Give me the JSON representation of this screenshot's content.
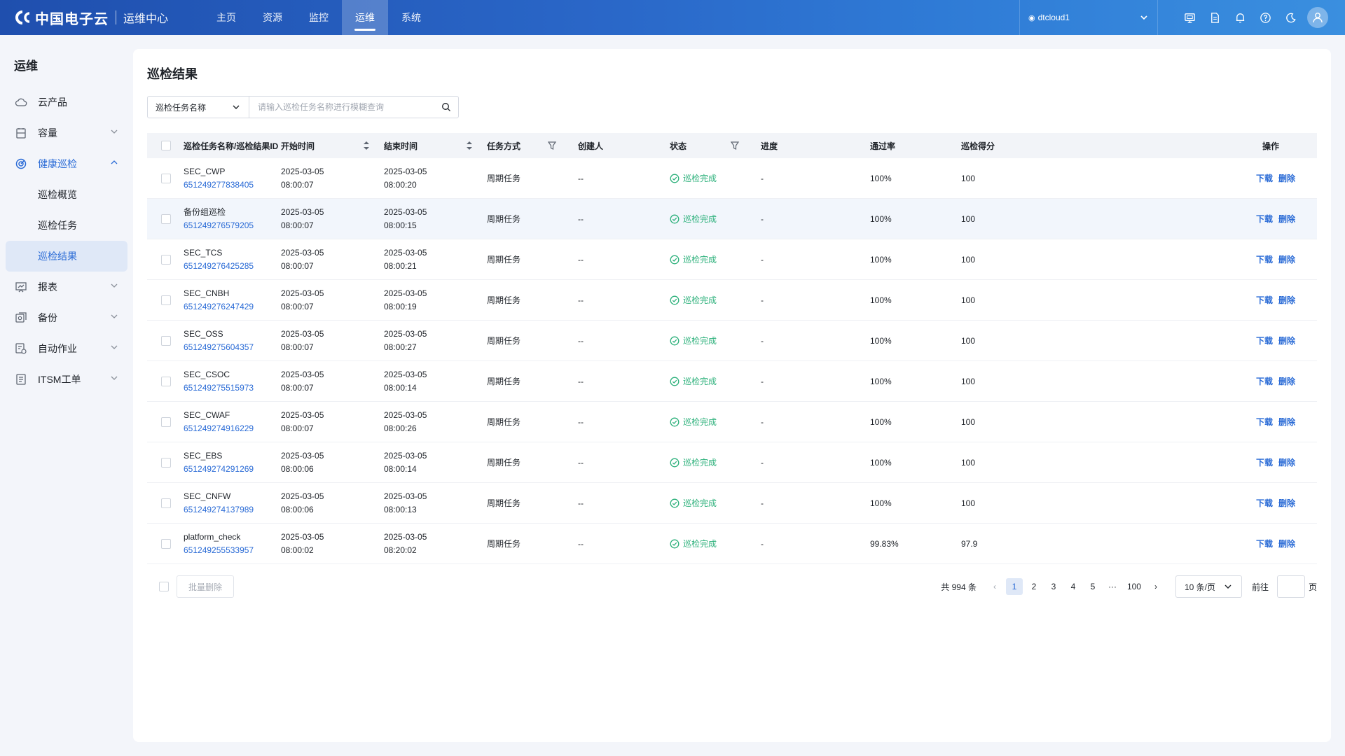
{
  "topbar": {
    "brand": "中国电子云",
    "subtitle": "运维中心",
    "nav": [
      {
        "label": "主页",
        "active": false
      },
      {
        "label": "资源",
        "active": false
      },
      {
        "label": "监控",
        "active": false
      },
      {
        "label": "运维",
        "active": true
      },
      {
        "label": "系统",
        "active": false
      }
    ],
    "tenant": "dtcloud1",
    "icons": [
      "monitor-icon",
      "document-icon",
      "bell-icon",
      "help-icon",
      "moon-icon"
    ],
    "avatar_icon": "user-icon"
  },
  "sidebar": {
    "title": "运维",
    "items": [
      {
        "label": "云产品",
        "icon": "cloud-icon",
        "has_chevron": false
      },
      {
        "label": "容量",
        "icon": "capacity-icon",
        "has_chevron": true
      },
      {
        "label": "健康巡检",
        "icon": "health-check-icon",
        "has_chevron": true,
        "open": true
      },
      {
        "label": "报表",
        "icon": "report-icon",
        "has_chevron": true
      },
      {
        "label": "备份",
        "icon": "backup-icon",
        "has_chevron": true
      },
      {
        "label": "自动作业",
        "icon": "automation-icon",
        "has_chevron": true
      },
      {
        "label": "ITSM工单",
        "icon": "ticket-icon",
        "has_chevron": true
      }
    ],
    "sub_items": [
      {
        "label": "巡检概览",
        "active": false
      },
      {
        "label": "巡检任务",
        "active": false
      },
      {
        "label": "巡检结果",
        "active": true
      }
    ]
  },
  "main": {
    "title": "巡检结果",
    "search": {
      "field": "巡检任务名称",
      "placeholder": "请输入巡检任务名称进行模糊查询"
    }
  },
  "table": {
    "columns": [
      "巡检任务名称/巡检结果ID",
      "开始时间",
      "结束时间",
      "任务方式",
      "创建人",
      "状态",
      "进度",
      "通过率",
      "巡检得分",
      "操作"
    ],
    "rows": [
      {
        "name": "SEC_CWP",
        "id": "651249277838405",
        "start_date": "2025-03-05",
        "start_time": "08:00:07",
        "end_date": "2025-03-05",
        "end_time": "08:00:20",
        "mode": "周期任务",
        "creator": "--",
        "status": "巡检完成",
        "progress": "-",
        "pass_rate": "100%",
        "score": "100"
      },
      {
        "name": "备份组巡检",
        "id": "651249276579205",
        "start_date": "2025-03-05",
        "start_time": "08:00:07",
        "end_date": "2025-03-05",
        "end_time": "08:00:15",
        "mode": "周期任务",
        "creator": "--",
        "status": "巡检完成",
        "progress": "-",
        "pass_rate": "100%",
        "score": "100"
      },
      {
        "name": "SEC_TCS",
        "id": "651249276425285",
        "start_date": "2025-03-05",
        "start_time": "08:00:07",
        "end_date": "2025-03-05",
        "end_time": "08:00:21",
        "mode": "周期任务",
        "creator": "--",
        "status": "巡检完成",
        "progress": "-",
        "pass_rate": "100%",
        "score": "100"
      },
      {
        "name": "SEC_CNBH",
        "id": "651249276247429",
        "start_date": "2025-03-05",
        "start_time": "08:00:07",
        "end_date": "2025-03-05",
        "end_time": "08:00:19",
        "mode": "周期任务",
        "creator": "--",
        "status": "巡检完成",
        "progress": "-",
        "pass_rate": "100%",
        "score": "100"
      },
      {
        "name": "SEC_OSS",
        "id": "651249275604357",
        "start_date": "2025-03-05",
        "start_time": "08:00:07",
        "end_date": "2025-03-05",
        "end_time": "08:00:27",
        "mode": "周期任务",
        "creator": "--",
        "status": "巡检完成",
        "progress": "-",
        "pass_rate": "100%",
        "score": "100"
      },
      {
        "name": "SEC_CSOC",
        "id": "651249275515973",
        "start_date": "2025-03-05",
        "start_time": "08:00:07",
        "end_date": "2025-03-05",
        "end_time": "08:00:14",
        "mode": "周期任务",
        "creator": "--",
        "status": "巡检完成",
        "progress": "-",
        "pass_rate": "100%",
        "score": "100"
      },
      {
        "name": "SEC_CWAF",
        "id": "651249274916229",
        "start_date": "2025-03-05",
        "start_time": "08:00:07",
        "end_date": "2025-03-05",
        "end_time": "08:00:26",
        "mode": "周期任务",
        "creator": "--",
        "status": "巡检完成",
        "progress": "-",
        "pass_rate": "100%",
        "score": "100"
      },
      {
        "name": "SEC_EBS",
        "id": "651249274291269",
        "start_date": "2025-03-05",
        "start_time": "08:00:06",
        "end_date": "2025-03-05",
        "end_time": "08:00:14",
        "mode": "周期任务",
        "creator": "--",
        "status": "巡检完成",
        "progress": "-",
        "pass_rate": "100%",
        "score": "100"
      },
      {
        "name": "SEC_CNFW",
        "id": "651249274137989",
        "start_date": "2025-03-05",
        "start_time": "08:00:06",
        "end_date": "2025-03-05",
        "end_time": "08:00:13",
        "mode": "周期任务",
        "creator": "--",
        "status": "巡检完成",
        "progress": "-",
        "pass_rate": "100%",
        "score": "100"
      },
      {
        "name": "platform_check",
        "id": "651249255533957",
        "start_date": "2025-03-05",
        "start_time": "08:00:02",
        "end_date": "2025-03-05",
        "end_time": "08:20:02",
        "mode": "周期任务",
        "creator": "--",
        "status": "巡检完成",
        "progress": "-",
        "pass_rate": "99.83%",
        "score": "97.9"
      }
    ],
    "actions": [
      "下载",
      "删除"
    ]
  },
  "footer": {
    "batch_delete": "批量删除",
    "total": "共 994 条",
    "pages": [
      "1",
      "2",
      "3",
      "4",
      "5",
      "···",
      "100"
    ],
    "current_page": "1",
    "page_size": "10 条/页",
    "goto_label": "前往",
    "goto_unit": "页"
  },
  "colors": {
    "accent": "#2a6bd6",
    "success": "#2bb07a",
    "topbar_start": "#1f4fae",
    "topbar_end": "#3a8fdf"
  }
}
